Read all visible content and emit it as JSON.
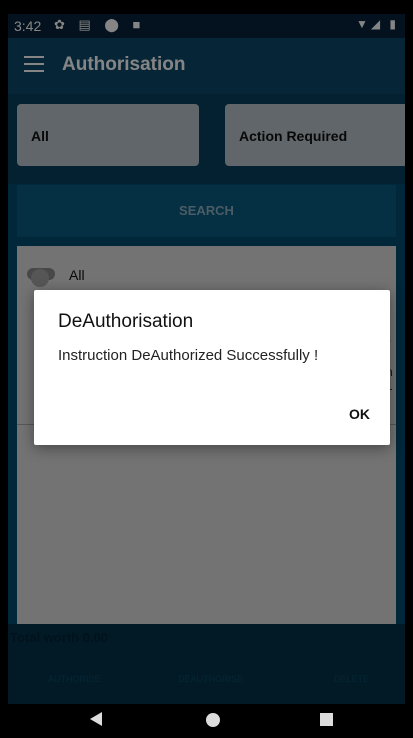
{
  "status_bar": {
    "time": "3:42",
    "left_icons": "✿ ▤ ⬤ ■",
    "right_icons": "▼◢ ▮"
  },
  "toolbar": {
    "title": "Authorisation"
  },
  "filters": {
    "left_value": "All",
    "right_value": "Action Required"
  },
  "search": {
    "label": "SEARCH"
  },
  "list": {
    "toggle_label": "All",
    "fragment_right_1": "0",
    "fragment_right_2": "n",
    "fragment_right_3": "1"
  },
  "footer": {
    "total": "Total worth 0.00",
    "buttons": [
      "AUTHORISE",
      "DEAUTHORISE",
      "DELETE"
    ]
  },
  "dialog": {
    "title": "DeAuthorisation",
    "message": "Instruction DeAuthorized Successfully !",
    "ok_label": "OK"
  },
  "icons": {
    "menu": "hamburger-menu-icon",
    "back": "back-triangle-icon",
    "home": "home-circle-icon",
    "recents": "recents-square-icon"
  },
  "colors": {
    "header": "#0c4a6a",
    "accent": "#014c6f",
    "dialog_bg": "#ffffff"
  }
}
